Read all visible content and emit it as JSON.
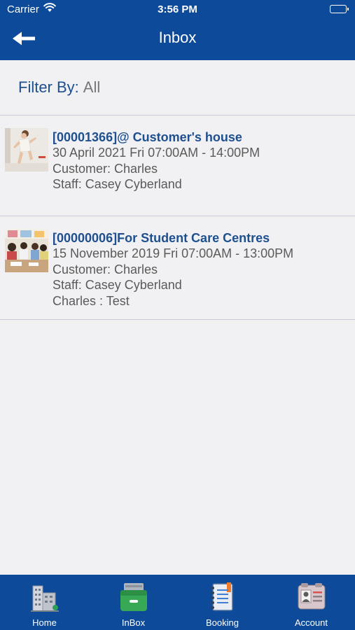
{
  "status_bar": {
    "carrier": "Carrier",
    "time": "3:56 PM"
  },
  "header": {
    "title": "Inbox"
  },
  "filter": {
    "label": "Filter By:",
    "value": "All"
  },
  "inbox": {
    "items": [
      {
        "title": "[00001366]@ Customer's house",
        "date": "30 April 2021 Fri 07:00AM - 14:00PM",
        "customer": "Customer: Charles",
        "staff": "Staff: Casey Cyberland"
      },
      {
        "title": "[00000006]For Student Care Centres",
        "date": "15 November 2019 Fri 07:00AM - 13:00PM",
        "customer": "Customer: Charles",
        "staff": "Staff: Casey Cyberland",
        "note": "Charles : Test"
      }
    ]
  },
  "tabs": [
    {
      "label": "Home",
      "icon": "building-icon"
    },
    {
      "label": "InBox",
      "icon": "inbox-tray-icon"
    },
    {
      "label": "Booking",
      "icon": "notebook-icon"
    },
    {
      "label": "Account",
      "icon": "id-card-icon"
    }
  ],
  "colors": {
    "primary": "#0d4a9a",
    "title_text": "#1e4f8f",
    "body_text": "#5a5a5a",
    "background": "#f1f1f3"
  }
}
